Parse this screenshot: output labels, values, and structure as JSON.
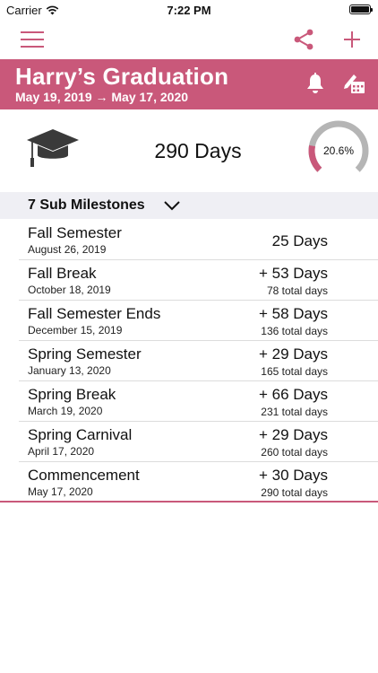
{
  "status_bar": {
    "carrier": "Carrier",
    "time": "7:22 PM"
  },
  "nav": {
    "menu_icon": "hamburger-icon",
    "share_icon": "share-icon",
    "add_icon": "plus-icon"
  },
  "event": {
    "title": "Harry’s Graduation",
    "dates": "May 19, 2019 → May 17, 2020",
    "bell_icon": "bell-icon",
    "edit_icon": "edit-calendar-icon"
  },
  "summary": {
    "icon": "graduation-cap-icon",
    "total_days": "290 Days",
    "progress_label": "20.6%",
    "progress_fraction": 0.206
  },
  "section": {
    "title": "7 Sub Milestones",
    "chevron_icon": "chevron-down-icon"
  },
  "milestones": [
    {
      "name": "Fall Semester",
      "date": "August 26, 2019",
      "days": "25 Days",
      "total": ""
    },
    {
      "name": "Fall Break",
      "date": "October 18, 2019",
      "days": "+ 53 Days",
      "total": "78 total days"
    },
    {
      "name": "Fall Semester Ends",
      "date": "December 15, 2019",
      "days": "+ 58 Days",
      "total": "136 total days"
    },
    {
      "name": "Spring Semester",
      "date": "January 13, 2020",
      "days": "+ 29 Days",
      "total": "165 total days"
    },
    {
      "name": "Spring Break",
      "date": "March 19, 2020",
      "days": "+ 66 Days",
      "total": "231 total days"
    },
    {
      "name": "Spring Carnival",
      "date": "April 17, 2020",
      "days": "+ 29 Days",
      "total": "260 total days"
    },
    {
      "name": "Commencement",
      "date": "May 17, 2020",
      "days": "+ 30 Days",
      "total": "290 total days"
    }
  ],
  "colors": {
    "accent": "#c9587a",
    "ring_track": "#b5b5b5",
    "section_bg": "#efeff4"
  }
}
